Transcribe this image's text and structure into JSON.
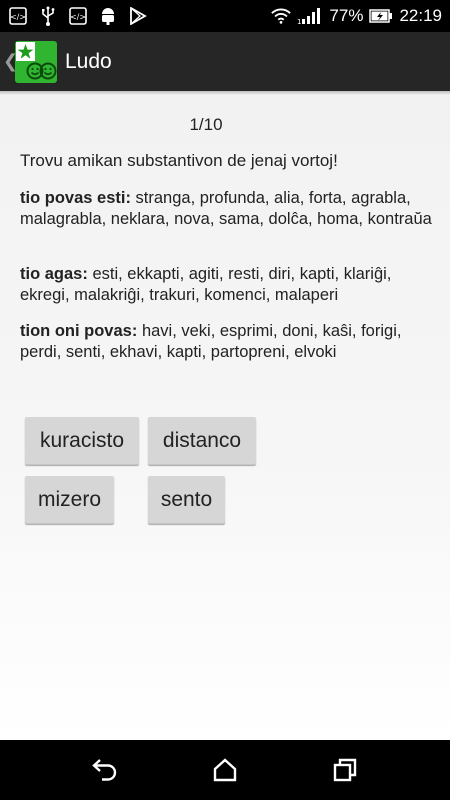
{
  "status_bar": {
    "battery_percent": "77%",
    "time": "22:19",
    "icons": [
      "code-icon",
      "usb-icon",
      "code-icon",
      "android-debug-icon",
      "play-store-icon",
      "wifi-icon",
      "signal-icon",
      "battery-charging-icon"
    ]
  },
  "action_bar": {
    "title": "Ludo",
    "back_glyph": "❮",
    "icon": "esperanto-flag-smiley-app-icon"
  },
  "quiz": {
    "progress": "1/10",
    "instruction": "Trovu amikan substantivon de jenaj vortoj!",
    "clues": [
      {
        "label": "tio povas esti:",
        "words": "stranga, profunda, alia, forta, agrabla, malagrabla, neklara, nova, sama, dolĉa, homa, kontraŭa"
      },
      {
        "label": "tio agas:",
        "words": "esti, ekkapti, agiti, resti, diri, kapti, klariĝi, ekregi, malakriĝi, trakuri, komenci, malaperi"
      },
      {
        "label": "tion oni povas:",
        "words": "havi, veki, esprimi, doni, kaŝi, forigi, perdi, senti, ekhavi, kapti, partopreni, elvoki"
      }
    ],
    "answers": [
      "kuracisto",
      "distanco",
      "mizero",
      "sento"
    ]
  },
  "nav_bar": {
    "buttons": [
      "back-icon",
      "home-icon",
      "recents-icon"
    ]
  },
  "colors": {
    "status_bar_bg": "#000000",
    "action_bar_bg": "#262626",
    "button_bg": "#d6d6d6",
    "app_icon_green": "#2fb52f"
  }
}
